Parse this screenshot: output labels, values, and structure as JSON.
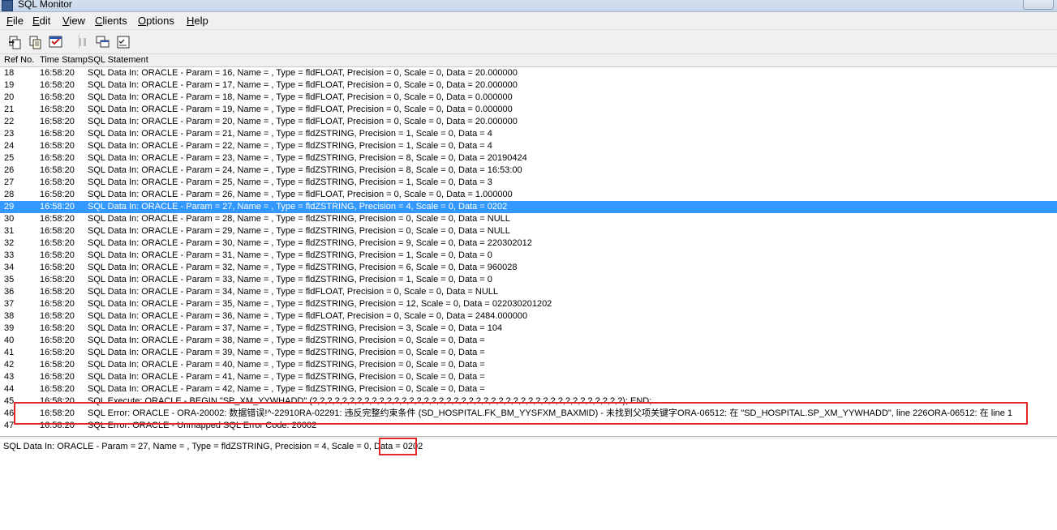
{
  "window": {
    "title": "SQL Monitor"
  },
  "menu": [
    {
      "label": "File",
      "ul": "F",
      "rest": "ile"
    },
    {
      "label": "Edit",
      "ul": "E",
      "rest": "dit"
    },
    {
      "label": "View",
      "ul": "V",
      "rest": "iew"
    },
    {
      "label": "Clients",
      "ul": "C",
      "rest": "lients"
    },
    {
      "label": "Options",
      "ul": "O",
      "rest": "ptions"
    },
    {
      "label": "Help",
      "ul": "H",
      "rest": "elp"
    }
  ],
  "toolbar": {
    "buttons": [
      "save-log-icon",
      "copy-icon",
      "print-icon",
      "pause-icon",
      "clients-icon",
      "options-icon"
    ]
  },
  "columns": {
    "ref": "Ref No.",
    "time": "Time Stamp",
    "stmt": "SQL Statement"
  },
  "rows": [
    {
      "ref": "18",
      "time": "16:58:20",
      "stmt": "SQL Data In: ORACLE - Param = 16, Name = , Type = fldFLOAT, Precision = 0, Scale = 0, Data = 20.000000"
    },
    {
      "ref": "19",
      "time": "16:58:20",
      "stmt": "SQL Data In: ORACLE - Param = 17, Name = , Type = fldFLOAT, Precision = 0, Scale = 0, Data = 20.000000"
    },
    {
      "ref": "20",
      "time": "16:58:20",
      "stmt": "SQL Data In: ORACLE - Param = 18, Name = , Type = fldFLOAT, Precision = 0, Scale = 0, Data = 0.000000"
    },
    {
      "ref": "21",
      "time": "16:58:20",
      "stmt": "SQL Data In: ORACLE - Param = 19, Name = , Type = fldFLOAT, Precision = 0, Scale = 0, Data = 0.000000"
    },
    {
      "ref": "22",
      "time": "16:58:20",
      "stmt": "SQL Data In: ORACLE - Param = 20, Name = , Type = fldFLOAT, Precision = 0, Scale = 0, Data = 20.000000"
    },
    {
      "ref": "23",
      "time": "16:58:20",
      "stmt": "SQL Data In: ORACLE - Param = 21, Name = , Type = fldZSTRING, Precision = 1, Scale = 0, Data = 4"
    },
    {
      "ref": "24",
      "time": "16:58:20",
      "stmt": "SQL Data In: ORACLE - Param = 22, Name = , Type = fldZSTRING, Precision = 1, Scale = 0, Data = 4"
    },
    {
      "ref": "25",
      "time": "16:58:20",
      "stmt": "SQL Data In: ORACLE - Param = 23, Name = , Type = fldZSTRING, Precision = 8, Scale = 0, Data = 20190424"
    },
    {
      "ref": "26",
      "time": "16:58:20",
      "stmt": "SQL Data In: ORACLE - Param = 24, Name = , Type = fldZSTRING, Precision = 8, Scale = 0, Data = 16:53:00"
    },
    {
      "ref": "27",
      "time": "16:58:20",
      "stmt": "SQL Data In: ORACLE - Param = 25, Name = , Type = fldZSTRING, Precision = 1, Scale = 0, Data = 3"
    },
    {
      "ref": "28",
      "time": "16:58:20",
      "stmt": "SQL Data In: ORACLE - Param = 26, Name = , Type = fldFLOAT, Precision = 0, Scale = 0, Data = 1.000000"
    },
    {
      "ref": "29",
      "time": "16:58:20",
      "stmt": "SQL Data In: ORACLE - Param = 27, Name = , Type = fldZSTRING, Precision = 4, Scale = 0, Data = 0202",
      "selected": true
    },
    {
      "ref": "30",
      "time": "16:58:20",
      "stmt": "SQL Data In: ORACLE - Param = 28, Name = , Type = fldZSTRING, Precision = 0, Scale = 0, Data = NULL"
    },
    {
      "ref": "31",
      "time": "16:58:20",
      "stmt": "SQL Data In: ORACLE - Param = 29, Name = , Type = fldZSTRING, Precision = 0, Scale = 0, Data = NULL"
    },
    {
      "ref": "32",
      "time": "16:58:20",
      "stmt": "SQL Data In: ORACLE - Param = 30, Name = , Type = fldZSTRING, Precision = 9, Scale = 0, Data = 220302012"
    },
    {
      "ref": "33",
      "time": "16:58:20",
      "stmt": "SQL Data In: ORACLE - Param = 31, Name = , Type = fldZSTRING, Precision = 1, Scale = 0, Data = 0"
    },
    {
      "ref": "34",
      "time": "16:58:20",
      "stmt": "SQL Data In: ORACLE - Param = 32, Name = , Type = fldZSTRING, Precision = 6, Scale = 0, Data = 960028"
    },
    {
      "ref": "35",
      "time": "16:58:20",
      "stmt": "SQL Data In: ORACLE - Param = 33, Name = , Type = fldZSTRING, Precision = 1, Scale = 0, Data = 0"
    },
    {
      "ref": "36",
      "time": "16:58:20",
      "stmt": "SQL Data In: ORACLE - Param = 34, Name = , Type = fldFLOAT, Precision = 0, Scale = 0, Data = NULL"
    },
    {
      "ref": "37",
      "time": "16:58:20",
      "stmt": "SQL Data In: ORACLE - Param = 35, Name = , Type = fldZSTRING, Precision = 12, Scale = 0, Data = 022030201202"
    },
    {
      "ref": "38",
      "time": "16:58:20",
      "stmt": "SQL Data In: ORACLE - Param = 36, Name = , Type = fldFLOAT, Precision = 0, Scale = 0, Data = 2484.000000"
    },
    {
      "ref": "39",
      "time": "16:58:20",
      "stmt": "SQL Data In: ORACLE - Param = 37, Name = , Type = fldZSTRING, Precision = 3, Scale = 0, Data = 104"
    },
    {
      "ref": "40",
      "time": "16:58:20",
      "stmt": "SQL Data In: ORACLE - Param = 38, Name = , Type = fldZSTRING, Precision = 0, Scale = 0, Data ="
    },
    {
      "ref": "41",
      "time": "16:58:20",
      "stmt": "SQL Data In: ORACLE - Param = 39, Name = , Type = fldZSTRING, Precision = 0, Scale = 0, Data ="
    },
    {
      "ref": "42",
      "time": "16:58:20",
      "stmt": "SQL Data In: ORACLE - Param = 40, Name = , Type = fldZSTRING, Precision = 0, Scale = 0, Data ="
    },
    {
      "ref": "43",
      "time": "16:58:20",
      "stmt": "SQL Data In: ORACLE - Param = 41, Name = , Type = fldZSTRING, Precision = 0, Scale = 0, Data ="
    },
    {
      "ref": "44",
      "time": "16:58:20",
      "stmt": "SQL Data In: ORACLE - Param = 42, Name = , Type = fldZSTRING, Precision = 0, Scale = 0, Data ="
    },
    {
      "ref": "45",
      "time": "16:58:20",
      "stmt": "SQL Execute: ORACLE - BEGIN \"SP_XM_YYWHADD\" (?,?,?,?,?,?,?,?,?,?,?,?,?,?,?,?,?,?,?,?,?,?,?,?,?,?,?,?,?,?,?,?,?,?,?,?,?,?,?,?,?,?); END;"
    },
    {
      "ref": "46",
      "time": "16:58:20",
      "stmt": "SQL Error: ORACLE - ORA-20002: 数据错误!^-22910RA-02291: 违反完整约束条件 (SD_HOSPITAL.FK_BM_YYSFXM_BAXMID) - 未找到父项关键字ORA-06512: 在 \"SD_HOSPITAL.SP_XM_YYWHADD\", line 226ORA-06512: 在 line 1"
    },
    {
      "ref": "47",
      "time": "16:58:20",
      "stmt": "SQL Error: ORACLE - Unmapped SQL Error Code: 20002"
    }
  ],
  "detail": {
    "text": "SQL Data In: ORACLE - Param = 27, Name = , Type = fldZSTRING, Precision = 4, Scale = 0, Data = 0202"
  }
}
